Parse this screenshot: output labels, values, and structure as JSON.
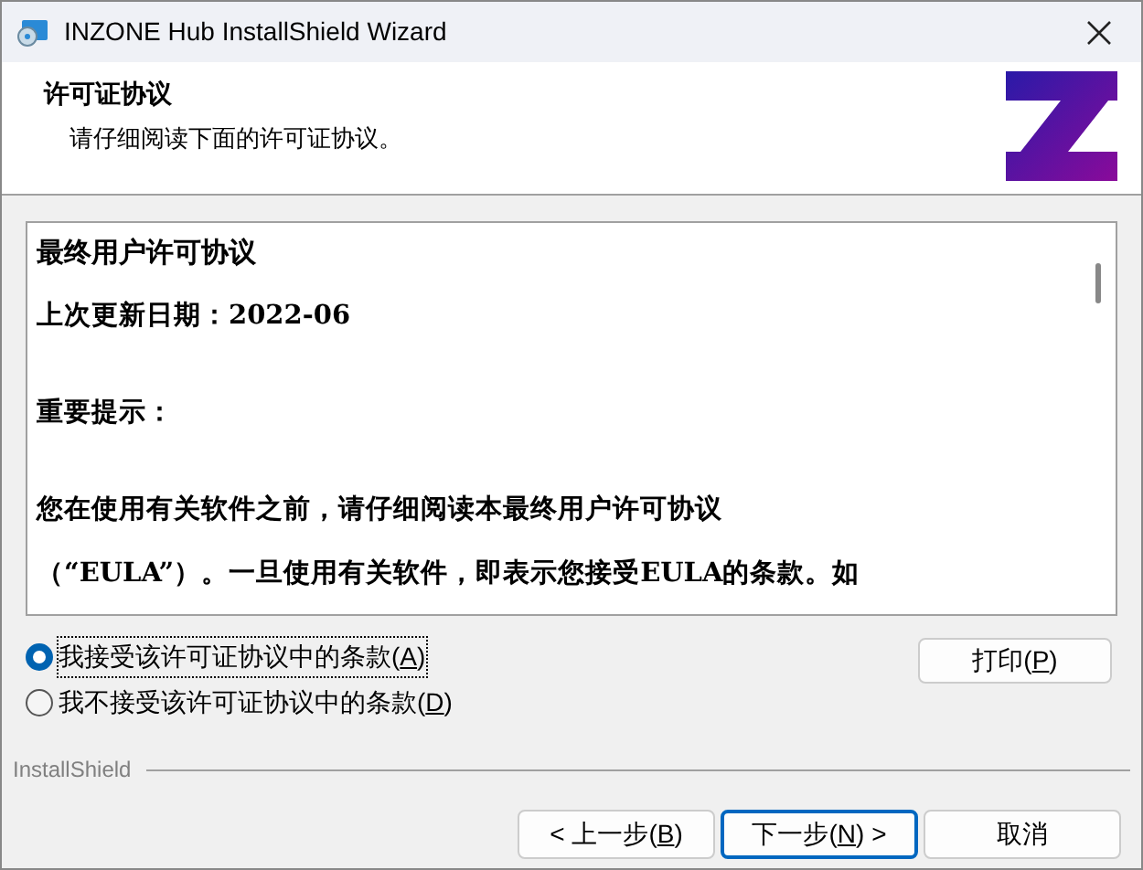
{
  "window": {
    "title": "INZONE Hub InstallShield Wizard"
  },
  "header": {
    "title": "许可证协议",
    "subtitle": "请仔细阅读下面的许可证协议。"
  },
  "license": {
    "lines": [
      {
        "kind": "heading",
        "text": "最终用户许可协议"
      },
      {
        "kind": "text",
        "text": "上次更新日期：2022-06"
      },
      {
        "kind": "gap"
      },
      {
        "kind": "text",
        "text": "重要提示："
      },
      {
        "kind": "gap"
      },
      {
        "kind": "text",
        "text": "您在使用有关软件之前，请仔细阅读本最终用户许可协议"
      },
      {
        "kind": "text",
        "text": "（“EULA”）。一旦使用有关软件，即表示您接受EULA的条款。如"
      }
    ]
  },
  "options": [
    {
      "label": "我接受该许可证协议中的条款(",
      "key": "A",
      "tail": ")",
      "selected": true
    },
    {
      "label": "我不接受该许可证协议中的条款(",
      "key": "D",
      "tail": ")",
      "selected": false
    }
  ],
  "print_button": {
    "label": "打印(",
    "key": "P",
    "tail": ")"
  },
  "brand": "InstallShield",
  "buttons": [
    {
      "label": "< 上一步(",
      "key": "B",
      "tail": ")",
      "default": false
    },
    {
      "label": "下一步(",
      "key": "N",
      "tail": ") >",
      "default": true
    },
    {
      "label": "取消",
      "default": false
    }
  ]
}
